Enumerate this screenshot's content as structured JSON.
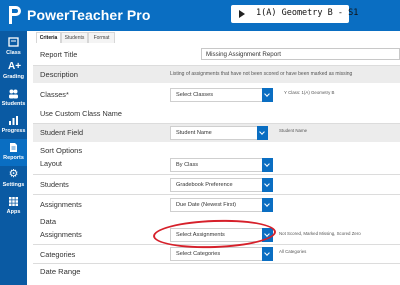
{
  "app": {
    "title": "PowerTeacher Pro",
    "class_selector": "1(A) Geometry B - S1"
  },
  "sidebar": {
    "items": [
      {
        "label": "Class",
        "icon": "class-icon"
      },
      {
        "label": "Grading",
        "icon": "grading-icon"
      },
      {
        "label": "Students",
        "icon": "students-icon"
      },
      {
        "label": "Progress",
        "icon": "progress-icon"
      },
      {
        "label": "Reports",
        "icon": "reports-icon"
      },
      {
        "label": "Settings",
        "icon": "settings-icon"
      },
      {
        "label": "Apps",
        "icon": "apps-icon"
      }
    ],
    "active": "Reports"
  },
  "tabs": [
    {
      "label": "Criteria"
    },
    {
      "label": "Students"
    },
    {
      "label": "Format"
    }
  ],
  "form": {
    "report_title_label": "Report Title",
    "report_title_value": "Missing Assignment Report",
    "description_label": "Description",
    "description_value": "Listing of assignments that have not been scored or have been marked as missing",
    "classes_label": "Classes*",
    "classes_select": "Select Classes",
    "classes_note": "Y Class: 1(A) Geometry B",
    "custom_class_label": "Use Custom Class Name",
    "student_field_label": "Student Field",
    "student_field_select": "Student Name",
    "student_field_note": "Student Name",
    "sort_options_label": "Sort Options",
    "layout_label": "Layout",
    "layout_select": "By Class",
    "students_label": "Students",
    "students_select": "Gradebook Preference",
    "assignments_sort_label": "Assignments",
    "assignments_sort_select": "Due Date (Newest First)",
    "data_label": "Data",
    "assignments_label": "Assignments",
    "assignments_select": "Select Assignments",
    "assignments_note": "Not Scored, Marked Missing, Scored Zero",
    "categories_label": "Categories",
    "categories_select": "Select Categories",
    "categories_note": "All Categories",
    "date_range_label": "Date Range"
  },
  "colors": {
    "header_blue": "#0a6ec2",
    "sidebar_blue": "#0a5aa3",
    "annotation_red": "#d6202a"
  }
}
